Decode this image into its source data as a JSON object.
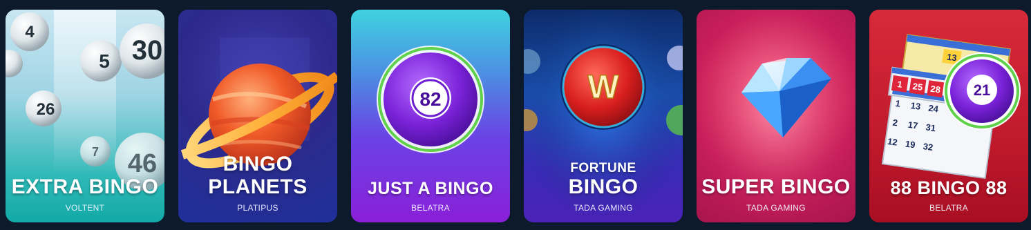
{
  "games": [
    {
      "title_lines": [
        "EXTRA BINGO"
      ],
      "provider": "VOLTENT",
      "art": {
        "type": "lottery-balls",
        "numbers": [
          "4",
          "5",
          "30",
          "26",
          "7",
          "46"
        ]
      }
    },
    {
      "title_lines": [
        "BINGO",
        "PLANETS"
      ],
      "provider": "PLATIPUS",
      "art": {
        "type": "planet"
      }
    },
    {
      "title_lines": [
        "JUST A BINGO"
      ],
      "provider": "BELATRA",
      "art": {
        "type": "bingo-ball",
        "number": "82"
      }
    },
    {
      "title_lines": [
        "FORTUNE",
        "BINGO"
      ],
      "provider": "TADA GAMING",
      "art": {
        "type": "bingo-ball",
        "letter": "W"
      }
    },
    {
      "title_lines": [
        "SUPER BINGO"
      ],
      "provider": "TADA GAMING",
      "art": {
        "type": "diamond"
      }
    },
    {
      "title_lines": [
        "88 BINGO 88"
      ],
      "provider": "BELATRA",
      "art": {
        "type": "bingo-cards-ball",
        "number": "21",
        "card_numbers": [
          "13",
          "1",
          "25",
          "28",
          "1",
          "13",
          "24",
          "2",
          "17",
          "31",
          "12",
          "19",
          "32"
        ]
      }
    }
  ]
}
